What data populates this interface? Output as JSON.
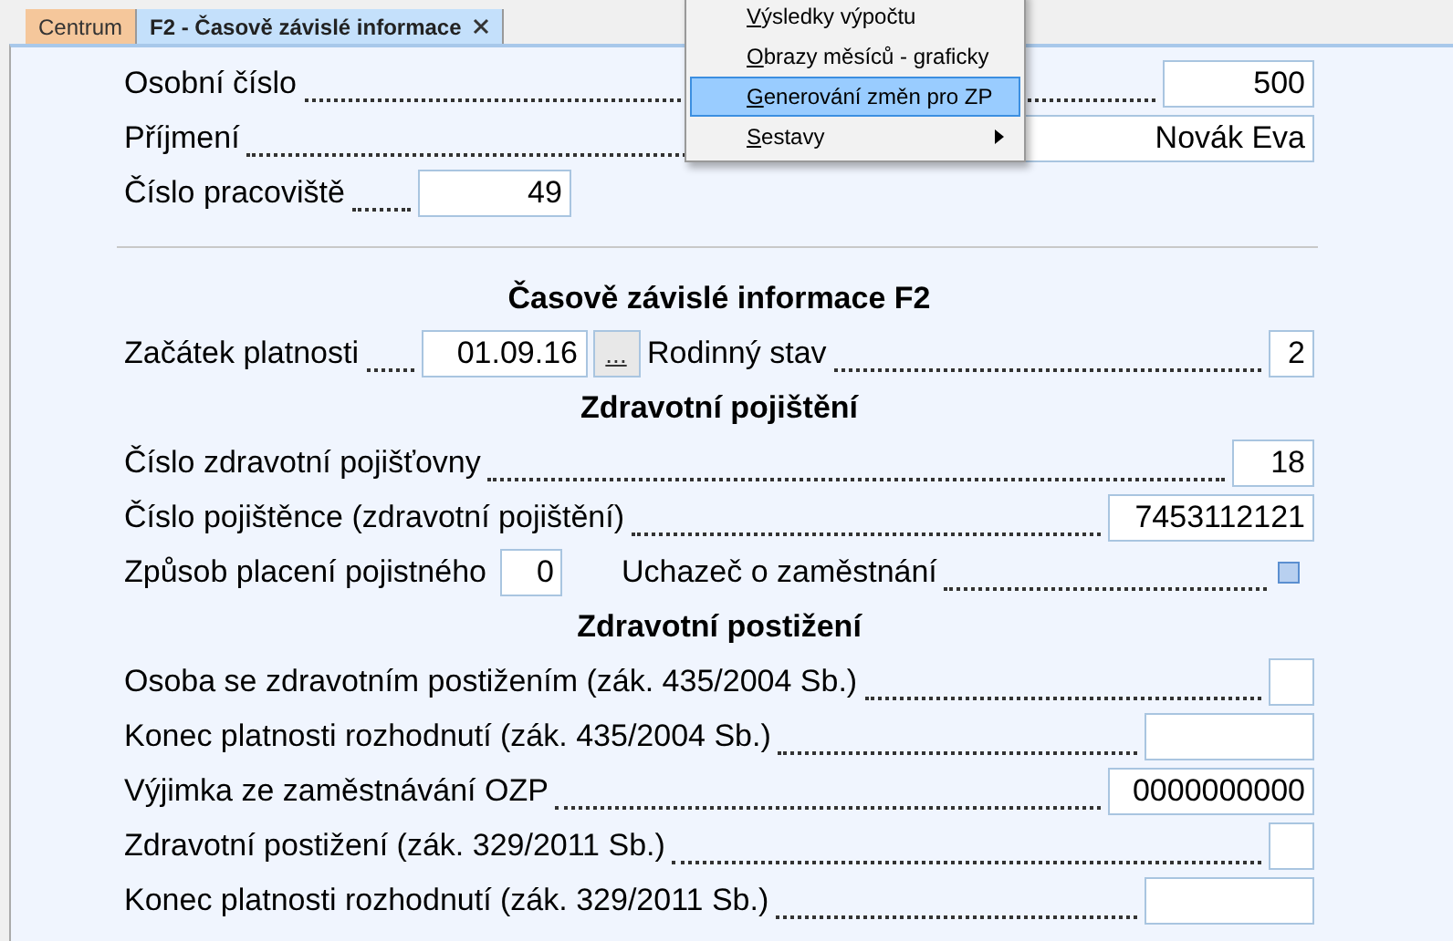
{
  "tabs": [
    {
      "label": "Centrum",
      "selected": false,
      "closable": false
    },
    {
      "label": "F2 - Časově závislé informace",
      "selected": true,
      "closable": true
    }
  ],
  "context_menu": {
    "items": [
      {
        "label": "Výsledky výpočtu",
        "selected": false,
        "submenu": false
      },
      {
        "label": "Obrazy měsíců - graficky",
        "selected": false,
        "submenu": false
      },
      {
        "label": "Generování změn pro ZP",
        "selected": true,
        "submenu": false
      },
      {
        "label": "Sestavy",
        "selected": false,
        "submenu": true
      }
    ]
  },
  "personal": [
    {
      "label": "Osobní číslo",
      "value": "500"
    },
    {
      "label": "Příjmení",
      "value": "Novák Eva"
    },
    {
      "label": "Číslo pracoviště",
      "value": "49"
    }
  ],
  "time_dependent": {
    "title": "Časově závislé informace F2",
    "start_date": {
      "label": "Začátek platnosti",
      "value": "01.09.16",
      "button": "..."
    },
    "marital_status": {
      "label": "Rodinný stav",
      "value": "2"
    }
  },
  "health_insurance": {
    "title": "Zdravotní pojištění",
    "rows": [
      {
        "label": "Číslo zdravotní pojišťovny",
        "value": "18"
      },
      {
        "label": "Číslo pojištěnce (zdravotní pojištění)",
        "value": "7453112121"
      }
    ],
    "payment_method": {
      "label": "Způsob placení pojistného",
      "value": "0"
    },
    "job_seeker": {
      "label": "Uchazeč o zaměstnání",
      "checked": false
    }
  },
  "disability": {
    "title": "Zdravotní postižení",
    "rows": [
      {
        "label": "Osoba se zdravotním postižením (zák. 435/2004 Sb.)"
      },
      {
        "label": "Konec platnosti rozhodnutí (zák. 435/2004 Sb.)"
      },
      {
        "label": "Výjimka ze zaměstnávání OZP",
        "value": "0000000000"
      },
      {
        "label": "Zdravotní postižení (zák. 329/2011 Sb.)"
      },
      {
        "label": "Konec platnosti rozhodnutí (zák. 329/2011 Sb.)"
      }
    ]
  }
}
